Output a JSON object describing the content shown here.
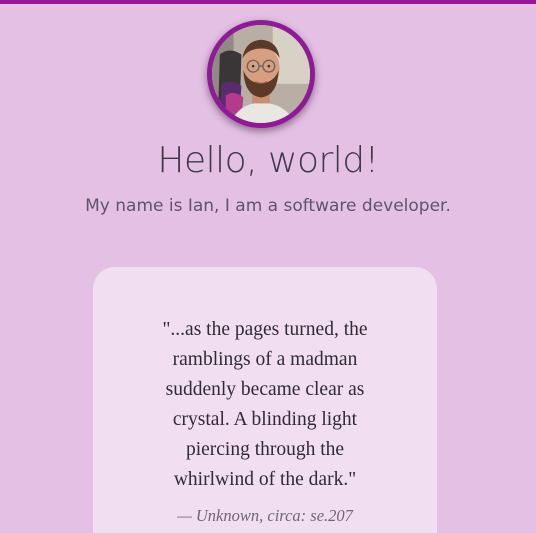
{
  "theme": {
    "background": "#e4c1e4",
    "accent": "#9b129b",
    "card_background": "#f1dff1"
  },
  "profile": {
    "avatar_icon": "profile-photo",
    "greeting": "Hello, world!",
    "subtitle": "My name is Ian, I am a software developer."
  },
  "quote": {
    "text": "\"...as the pages turned, the ramblings of a madman suddenly became clear as crystal. A blinding light piercing through the whirlwind of the dark.\"",
    "attribution": "— Unknown, circa: se.207"
  }
}
